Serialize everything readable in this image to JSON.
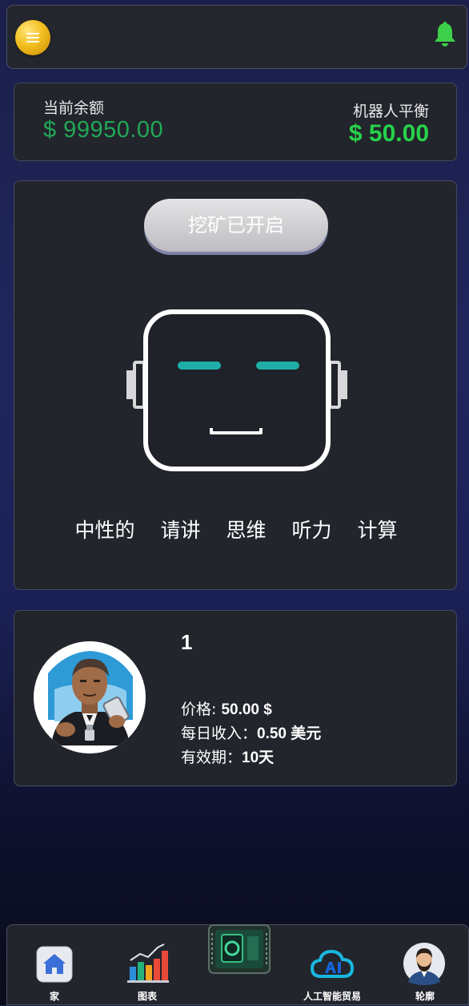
{
  "header": {
    "menu_icon": "menu-icon",
    "bell_icon": "bell-icon",
    "colors": {
      "menu": "#f3bf1f",
      "bell": "#3ecf4a"
    }
  },
  "balance": {
    "current_label": "当前余额",
    "current_value": "$ 99950.00",
    "robot_label": "机器人平衡",
    "robot_value": "$ 50.00",
    "colors": {
      "current": "#22a857",
      "robot": "#27d24a"
    }
  },
  "robot": {
    "mining_button": "挖矿已开启",
    "face_icon": "robot-face-icon",
    "modes": [
      "中性的",
      "请讲",
      "思维",
      "听力",
      "计算"
    ],
    "colors": {
      "eyes": "#1eaea8"
    }
  },
  "product": {
    "name": "1",
    "price_label": "价格: ",
    "price_value": "50.00 $",
    "daily_label": "每日收入：",
    "daily_value": "0.50 美元",
    "validity_label": "有效期：",
    "validity_value": "10天"
  },
  "nav": {
    "items": [
      {
        "label": "家",
        "icon": "home-icon"
      },
      {
        "label": "图表",
        "icon": "chart-icon"
      },
      {
        "label": "",
        "icon": "mining-chip-icon"
      },
      {
        "label": "人工智能贸易",
        "icon": "ai-cloud-icon"
      },
      {
        "label": "轮廓",
        "icon": "profile-avatar-icon"
      }
    ]
  }
}
